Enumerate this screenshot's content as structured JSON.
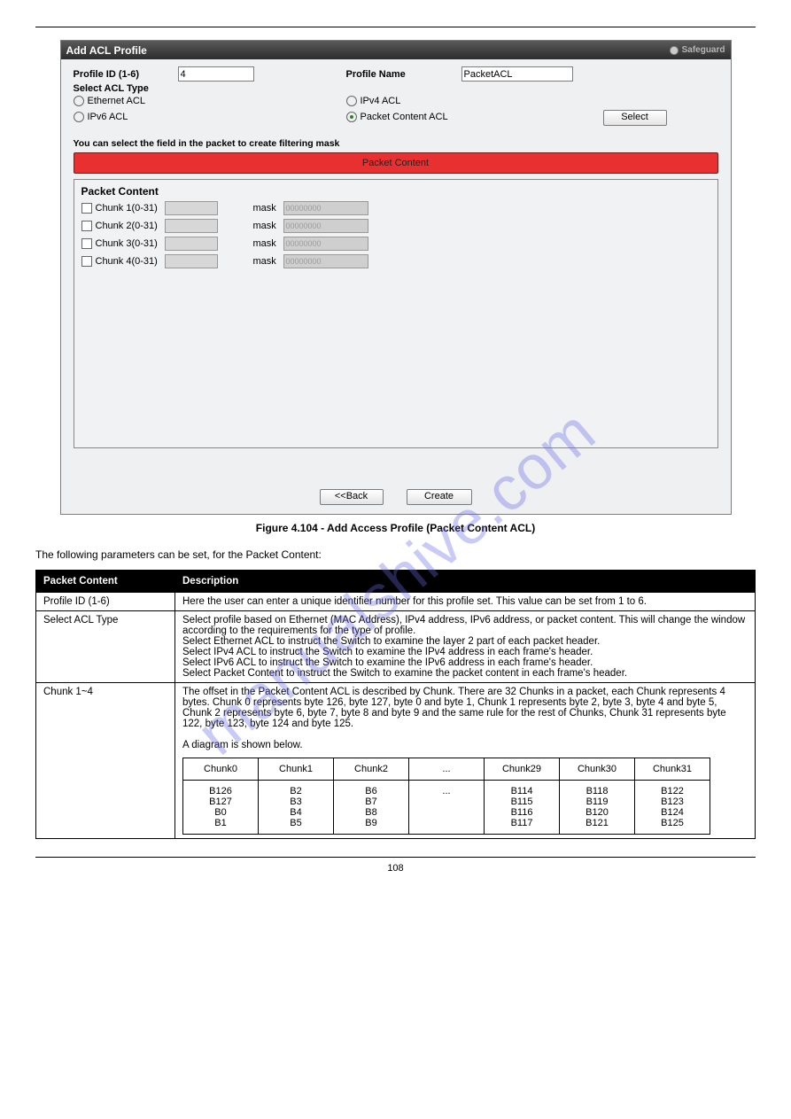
{
  "page": {
    "watermark": "manualshive.com",
    "number": "108"
  },
  "panel": {
    "title": "Add ACL Profile",
    "safeguard": "Safeguard",
    "profile_id_label": "Profile ID (1-6)",
    "profile_id_value": "4",
    "profile_name_label": "Profile Name",
    "profile_name_value": "PacketACL",
    "select_type_label": "Select ACL Type",
    "radio_ethernet": "Ethernet ACL",
    "radio_ipv4": "IPv4 ACL",
    "radio_ipv6": "IPv6 ACL",
    "radio_packet": "Packet Content ACL",
    "select_btn": "Select",
    "instruction": "You can select the field in the packet to create filtering mask",
    "redband": "Packet Content",
    "content_hdr": "Packet Content",
    "chunks": [
      {
        "label": "Chunk 1(0-31)",
        "mask_label": "mask",
        "mask_ph": "00000000"
      },
      {
        "label": "Chunk 2(0-31)",
        "mask_label": "mask",
        "mask_ph": "00000000"
      },
      {
        "label": "Chunk 3(0-31)",
        "mask_label": "mask",
        "mask_ph": "00000000"
      },
      {
        "label": "Chunk 4(0-31)",
        "mask_label": "mask",
        "mask_ph": "00000000"
      }
    ],
    "back_btn": "<<Back",
    "create_btn": "Create"
  },
  "caption": "Figure 4.104 - Add Access Profile (Packet Content ACL)",
  "paragraph": "The following parameters can be set, for the Packet Content:",
  "cfg": {
    "hdr_left": "Packet Content",
    "hdr_right": "Description",
    "rows": [
      {
        "left": "Profile ID (1-6)",
        "right": "Here the user can enter a unique identifier number for this profile set. This value can be set from 1 to 6."
      },
      {
        "left": "Select ACL Type",
        "right": "Select profile based on Ethernet (MAC Address), IPv4 address, IPv6 address, or packet content. This will change the window according to the requirements for the type of profile.\nSelect Ethernet ACL to instruct the Switch to examine the layer 2 part of each packet header.\nSelect IPv4 ACL to instruct the Switch to examine the IPv4 address in each frame's header.\nSelect IPv6 ACL to instruct the Switch to examine the IPv6 address in each frame's header.\nSelect Packet Content to instruct the Switch to examine the packet content in each frame's header."
      },
      {
        "left": "Chunk 1~4",
        "right_intro": "The offset in the Packet Content ACL is described by Chunk. There are 32 Chunks in a packet, each Chunk represents 4 bytes. Chunk 0 represents byte 126, byte 127, byte 0 and byte 1, Chunk 1 represents byte 2, byte 3, byte 4 and byte 5, Chunk 2 represents byte 6, byte 7, byte 8 and byte 9 and the same rule for the rest of Chunks, Chunk 31 represents byte 122, byte 123, byte 124 and byte 125.\n\nA diagram is shown below.",
        "inner_header": [
          "Chunk0",
          "Chunk1",
          "Chunk2",
          "...",
          "Chunk29",
          "Chunk30",
          "Chunk31"
        ],
        "inner_row": [
          "B126\nB127\nB0\nB1",
          "B2\nB3\nB4\nB5",
          "B6\nB7\nB8\nB9",
          "...",
          "B114\nB115\nB116\nB117",
          "B118\nB119\nB120\nB121",
          "B122\nB123\nB124\nB125"
        ]
      }
    ]
  },
  "chart_data": {
    "type": "table",
    "title": "Chunk offset diagram",
    "columns": [
      "Chunk0",
      "Chunk1",
      "Chunk2",
      "...",
      "Chunk29",
      "Chunk30",
      "Chunk31"
    ],
    "rows": [
      [
        "B126 B127 B0 B1",
        "B2 B3 B4 B5",
        "B6 B7 B8 B9",
        "...",
        "B114 B115 B116 B117",
        "B118 B119 B120 B121",
        "B122 B123 B124 B125"
      ]
    ]
  }
}
